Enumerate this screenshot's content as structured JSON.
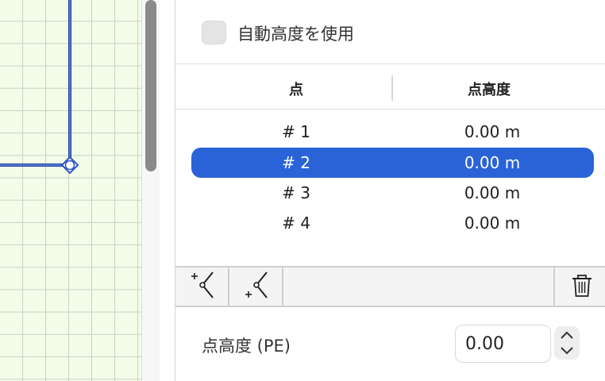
{
  "auto_height": {
    "label": "自動高度を使用",
    "checked": false
  },
  "table": {
    "columns": [
      "点",
      "点高度"
    ],
    "rows": [
      {
        "point": "# 1",
        "height": "0.00 m",
        "selected": false
      },
      {
        "point": "# 2",
        "height": "0.00 m",
        "selected": true
      },
      {
        "point": "# 3",
        "height": "0.00 m",
        "selected": false
      },
      {
        "point": "# 4",
        "height": "0.00 m",
        "selected": false
      }
    ]
  },
  "toolbar": {
    "buttons": [
      "add-point-before-icon",
      "add-point-after-icon",
      "trash-icon"
    ]
  },
  "point_height": {
    "label": "点高度 (PE)",
    "value": "0.00"
  },
  "colors": {
    "selection": "#2a63d7",
    "canvas_bg": "#f3fbe9",
    "shape_line": "#2f56c4"
  }
}
